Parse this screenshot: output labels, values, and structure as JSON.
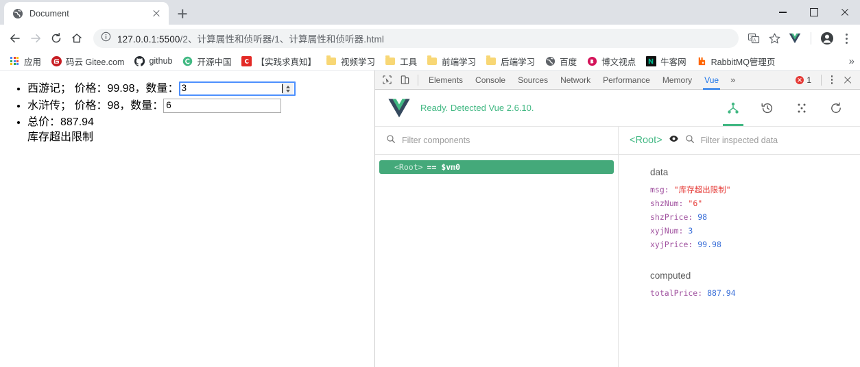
{
  "browser": {
    "tab": {
      "title": "Document",
      "favicon": "globe-icon",
      "close": "close-icon"
    },
    "new_tab": "+",
    "window_controls": {
      "minimize": "minimize-icon",
      "maximize": "maximize-icon",
      "close": "close-icon"
    },
    "nav": {
      "back": "back-arrow-icon",
      "forward": "forward-arrow-icon",
      "reload": "reload-icon",
      "home": "home-icon"
    },
    "omnibox": {
      "info_icon": "info-circle-icon",
      "url_host": "127.0.0.1:5500",
      "url_path": "/2、计算属性和侦听器/1、计算属性和侦听器.html"
    },
    "toolbar_icons": [
      {
        "name": "translate-icon"
      },
      {
        "name": "bookmark-star-icon"
      },
      {
        "name": "vue-devtools-extension-icon"
      },
      {
        "name": "profile-avatar-icon"
      },
      {
        "name": "chrome-menu-icon"
      }
    ],
    "bookmarks": [
      {
        "label": "应用",
        "icon": "apps-grid-icon"
      },
      {
        "label": "码云 Gitee.com",
        "icon": "gitee-icon"
      },
      {
        "label": "github",
        "icon": "github-icon"
      },
      {
        "label": "开源中国",
        "icon": "oschina-icon"
      },
      {
        "label": "【实践求真知】",
        "icon": "csdn-icon"
      },
      {
        "label": "视频学习",
        "icon": "folder-icon"
      },
      {
        "label": "工具",
        "icon": "folder-icon"
      },
      {
        "label": "前端学习",
        "icon": "folder-icon"
      },
      {
        "label": "后端学习",
        "icon": "folder-icon"
      },
      {
        "label": "百度",
        "icon": "globe-icon"
      },
      {
        "label": "博文视点",
        "icon": "broadview-icon"
      },
      {
        "label": "牛客网",
        "icon": "nowcoder-icon"
      },
      {
        "label": "RabbitMQ管理页",
        "icon": "rabbitmq-icon"
      }
    ],
    "bookmarks_overflow": "»"
  },
  "page": {
    "items": [
      {
        "label": "西游记； 价格：99.98，数量：",
        "input_value": "3",
        "input_type": "number"
      },
      {
        "label": "水浒传； 价格：98，数量：",
        "input_value": "6",
        "input_type": "text"
      },
      {
        "label": "总价：887.94",
        "sub_line": "库存超出限制"
      }
    ]
  },
  "devtools": {
    "tools": [
      {
        "name": "inspect-element-icon"
      },
      {
        "name": "device-toolbar-icon"
      }
    ],
    "tabs": [
      {
        "label": "Elements",
        "active": false
      },
      {
        "label": "Console",
        "active": false
      },
      {
        "label": "Sources",
        "active": false
      },
      {
        "label": "Network",
        "active": false
      },
      {
        "label": "Performance",
        "active": false
      },
      {
        "label": "Memory",
        "active": false
      },
      {
        "label": "Vue",
        "active": true
      }
    ],
    "more_tabs": "»",
    "error_count": "1",
    "menu_icon": "devtools-menu-icon",
    "close_icon": "devtools-close-icon"
  },
  "vue_panel": {
    "logo": "vue-logo-icon",
    "status": "Ready. Detected Vue 2.6.10.",
    "actions": [
      {
        "name": "component-tree-icon",
        "active": true
      },
      {
        "name": "timeline-history-icon",
        "active": false
      },
      {
        "name": "vuex-dots-icon",
        "active": false
      },
      {
        "name": "refresh-icon",
        "active": false
      }
    ],
    "component_filter": {
      "placeholder": "Filter components",
      "icon": "search-icon",
      "value": ""
    },
    "tree": [
      {
        "tag": "<Root>",
        "alias": "== $vm0",
        "selected": true
      }
    ],
    "inspector": {
      "selected_component": "<Root>",
      "eye_icon": "eye-icon",
      "data_filter": {
        "placeholder": "Filter inspected data",
        "icon": "search-icon",
        "value": ""
      },
      "groups": [
        {
          "title": "data",
          "entries": [
            {
              "key": "msg",
              "value": "\"库存超出限制\"",
              "type": "string"
            },
            {
              "key": "shzNum",
              "value": "\"6\"",
              "type": "string"
            },
            {
              "key": "shzPrice",
              "value": "98",
              "type": "number"
            },
            {
              "key": "xyjNum",
              "value": "3",
              "type": "number"
            },
            {
              "key": "xyjPrice",
              "value": "99.98",
              "type": "number"
            }
          ]
        },
        {
          "title": "computed",
          "entries": [
            {
              "key": "totalPrice",
              "value": "887.94",
              "type": "number"
            }
          ]
        }
      ]
    }
  },
  "colors": {
    "vue_green": "#42b883",
    "chrome_blue": "#1a73e8",
    "error_red": "#e53935",
    "key_purple": "#a0519f",
    "number_blue": "#3a6fd8"
  }
}
